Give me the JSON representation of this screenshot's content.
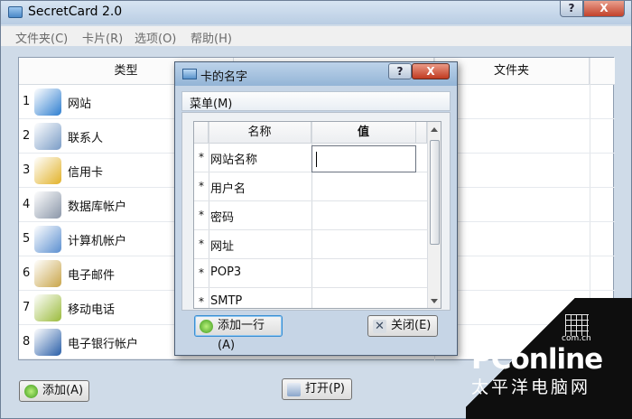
{
  "app": {
    "title": "SecretCard 2.0",
    "help_glyph": "?",
    "close_glyph": "X"
  },
  "menubar": [
    "文件夹(C)",
    "卡片(R)",
    "选项(O)",
    "帮助(H)"
  ],
  "table": {
    "headers": [
      "类型",
      "文件夹"
    ],
    "rows": [
      {
        "num": "1",
        "label": "网站",
        "icon": "internet-explorer-icon",
        "color": "#2f7fd0"
      },
      {
        "num": "2",
        "label": "联系人",
        "icon": "contact-card-icon",
        "color": "#7a9cc6"
      },
      {
        "num": "3",
        "label": "信用卡",
        "icon": "credit-card-icon",
        "color": "#e2b22a"
      },
      {
        "num": "4",
        "label": "数据库帐户",
        "icon": "database-icon",
        "color": "#8a96a8"
      },
      {
        "num": "5",
        "label": "计算机帐户",
        "icon": "computer-monitor-icon",
        "color": "#5b8fd0"
      },
      {
        "num": "6",
        "label": "电子邮件",
        "icon": "email-envelope-icon",
        "color": "#c9a54a"
      },
      {
        "num": "7",
        "label": "移动电话",
        "icon": "mobile-phone-icon",
        "color": "#9bbb3c"
      },
      {
        "num": "8",
        "label": "电子银行帐户",
        "icon": "bank-icon",
        "color": "#2a5fa8"
      }
    ]
  },
  "buttons": {
    "add": "添加(A)",
    "open": "打开(P)"
  },
  "dialog": {
    "title": "卡的名字",
    "help_glyph": "?",
    "close_glyph": "X",
    "menu": "菜单(M)",
    "grid_headers": [
      "名称",
      "值"
    ],
    "rows": [
      {
        "star": "*",
        "name": "网站名称",
        "value": ""
      },
      {
        "star": "*",
        "name": "用户名",
        "value": ""
      },
      {
        "star": "*",
        "name": "密码",
        "value": ""
      },
      {
        "star": "*",
        "name": "网址",
        "value": ""
      },
      {
        "star": "*",
        "name": "POP3",
        "value": ""
      },
      {
        "star": "*",
        "name": "SMTP",
        "value": ""
      }
    ],
    "add_row_label": "添加一行(A)",
    "close_label": "关闭(E)"
  },
  "watermark": {
    "logo": "PConline",
    "sub": "太平洋电脑网",
    "url": "com.cn"
  }
}
